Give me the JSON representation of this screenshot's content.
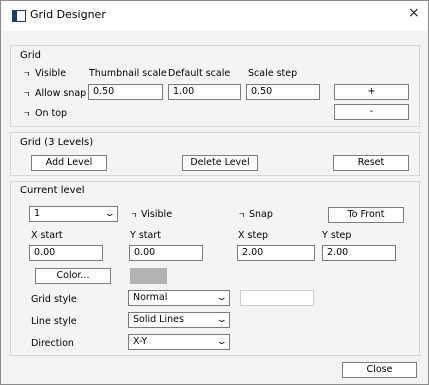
{
  "window": {
    "title": "Grid Designer",
    "close_symbol": "×"
  },
  "grid": {
    "title": "Grid",
    "visible_label": "Visible",
    "allow_snap_label": "Allow snap",
    "on_top_label": "On top",
    "thumbnail_scale_label": "Thumbnail scale",
    "default_scale_label": "Default scale",
    "scale_step_label": "Scale step",
    "thumbnail_scale_value": "0.50",
    "default_scale_value": "1.00",
    "scale_step_value": "0.50",
    "plus_label": "+",
    "minus_label": "-"
  },
  "levels": {
    "title": "Grid (3 Levels)",
    "add_label": "Add Level",
    "delete_label": "Delete Level",
    "reset_label": "Reset"
  },
  "current": {
    "title": "Current level",
    "level_value": "1",
    "visible_label": "Visible",
    "snap_label": "Snap",
    "to_front_label": "To Front",
    "x_start_label": "X start",
    "y_start_label": "Y start",
    "x_step_label": "X step",
    "y_step_label": "Y step",
    "x_start_value": "0.00",
    "y_start_value": "0.00",
    "x_step_value": "2.00",
    "y_step_value": "2.00",
    "color_label": "Color...",
    "grid_style_label": "Grid style",
    "grid_style_value": "Normal",
    "line_style_label": "Line style",
    "line_style_value": "Solid Lines",
    "direction_label": "Direction",
    "direction_value": "X-Y",
    "swatch_color": "#b3b3b3"
  },
  "footer": {
    "close_label": "Close"
  },
  "icons": {
    "checkbox_glyph": "ㄱ",
    "dropdown": "chevron-down-icon"
  }
}
